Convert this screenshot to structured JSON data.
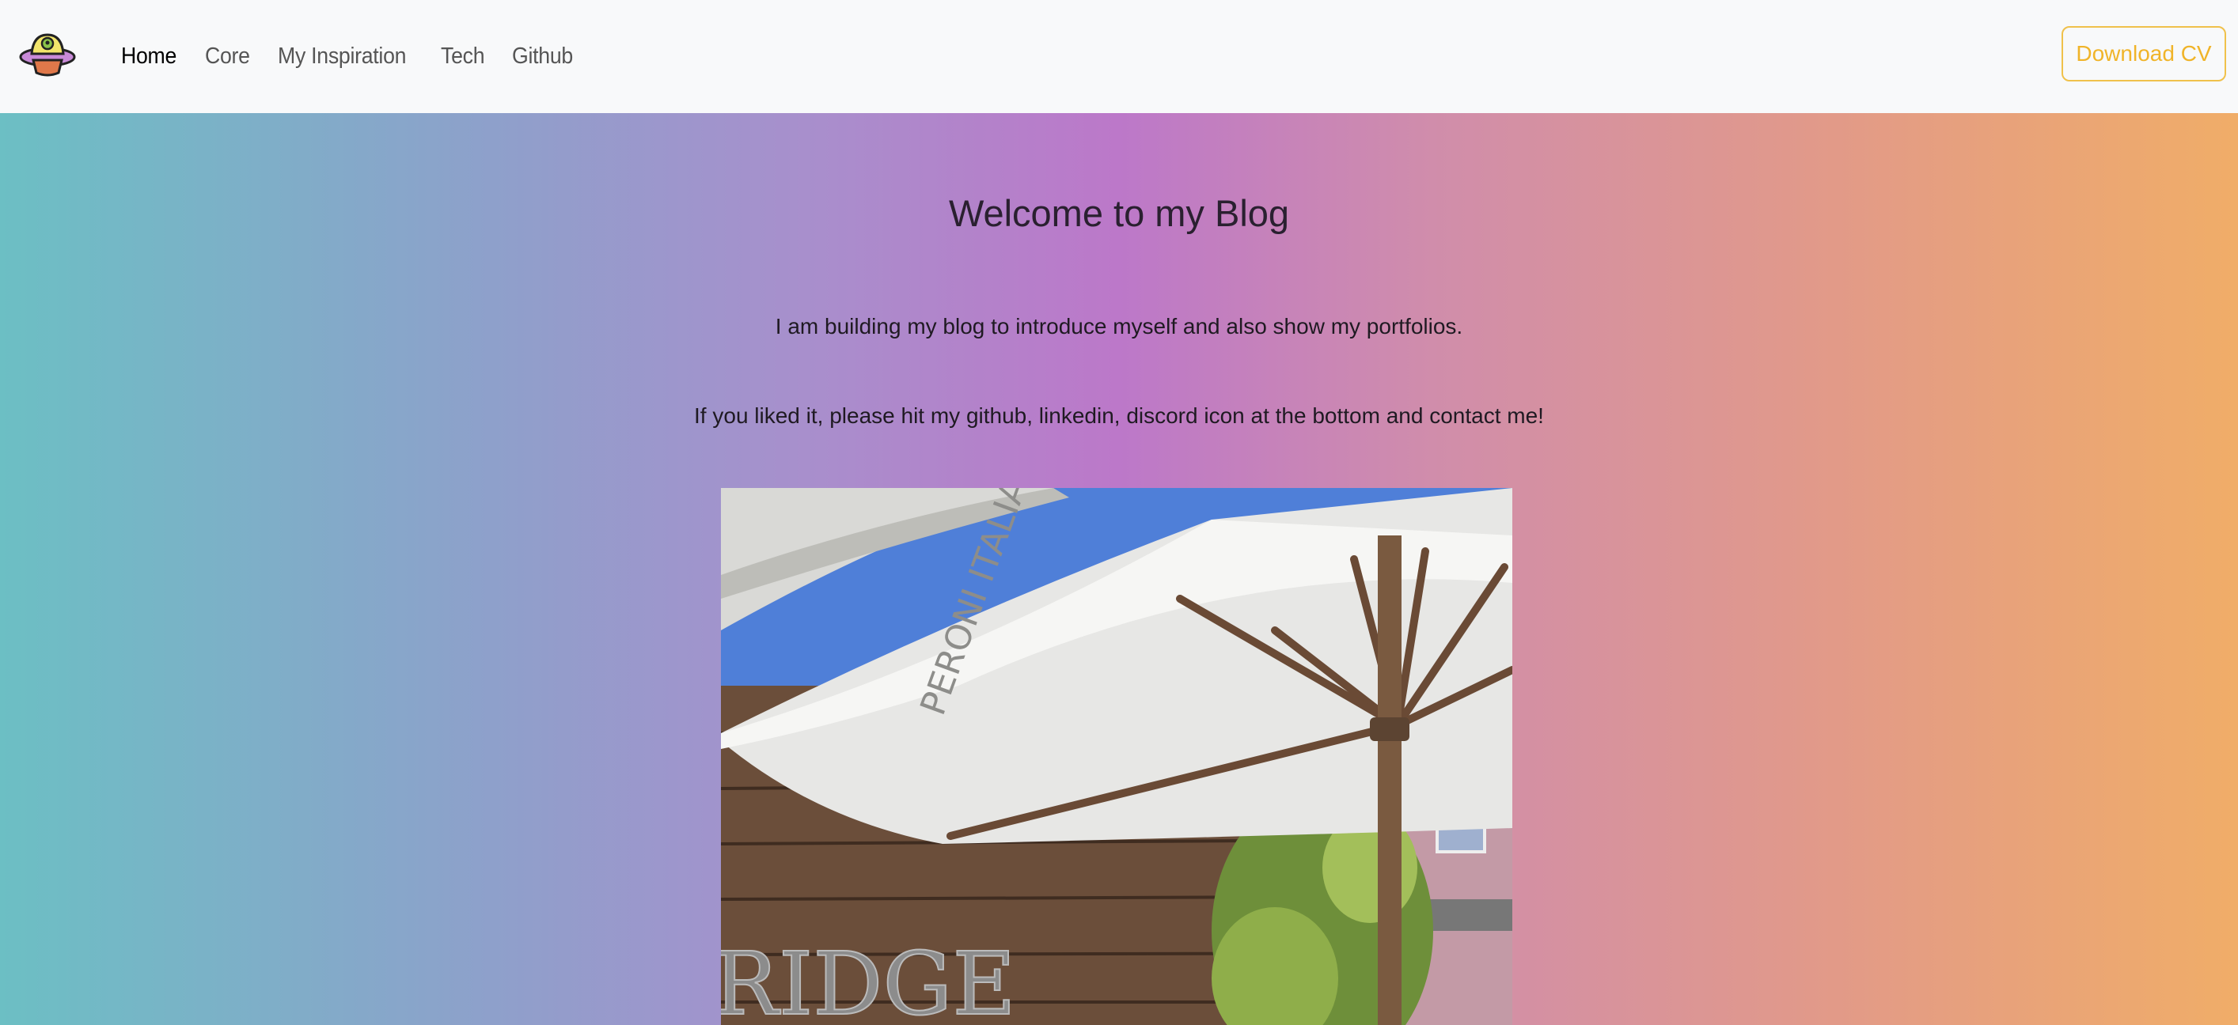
{
  "navbar": {
    "logo_icon": "alien-ufo-icon",
    "links": [
      {
        "label": "Home",
        "active": true
      },
      {
        "label": "Core",
        "active": false
      },
      {
        "label": "My Inspiration",
        "active": false
      },
      {
        "label": "Tech",
        "active": false
      },
      {
        "label": "Github",
        "active": false
      }
    ],
    "download_label": "Download CV"
  },
  "hero": {
    "title": "Welcome to my Blog",
    "paragraph_1": "I am building my blog to introduce myself and also show my portfolios.",
    "paragraph_2": "If you liked it, please hit my github, linkedin, discord icon at the bottom and contact me!",
    "gradient": [
      "#6cbfc4",
      "#bc78c9",
      "#f0ad68"
    ],
    "photo_sign_text": "RIDGE",
    "photo_umbrella_text": "PERONI ITALIA"
  }
}
